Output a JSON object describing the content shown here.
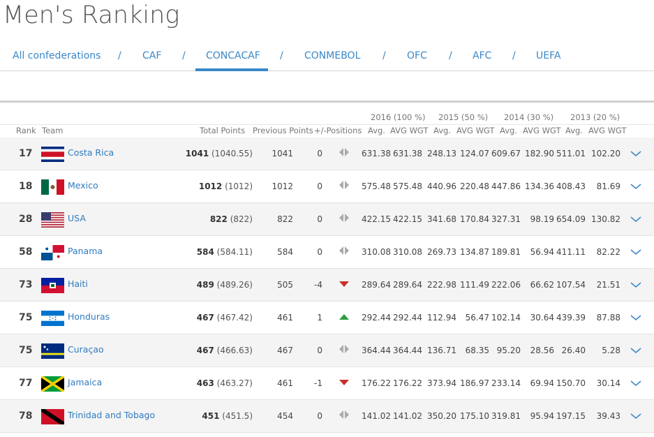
{
  "page_title": "Men's Ranking",
  "tabs": [
    {
      "label": "All confederations",
      "active": false
    },
    {
      "label": "CAF",
      "active": false
    },
    {
      "label": "CONCACAF",
      "active": true
    },
    {
      "label": "CONMEBOL",
      "active": false
    },
    {
      "label": "OFC",
      "active": false
    },
    {
      "label": "AFC",
      "active": false
    },
    {
      "label": "UEFA",
      "active": false
    }
  ],
  "tab_separator": "/",
  "groups": [
    "2016 (100 %)",
    "2015 (50 %)",
    "2014 (30 %)",
    "2013 (20 %)"
  ],
  "headers": {
    "rank": "Rank",
    "team": "Team",
    "total_points": "Total Points",
    "previous_points": "Previous Points",
    "positions": "+/-Positions",
    "avg": "Avg.",
    "avg_wgt": "AVG WGT"
  },
  "colors": {
    "link": "#2f7bc0",
    "up": "#2e9e3e",
    "down": "#c9302c",
    "neutral": "#aaaaaa"
  },
  "rows": [
    {
      "rank": "17",
      "team": "Costa Rica",
      "flag": "costa-rica",
      "points": "1041",
      "points_exact": "(1040.55)",
      "previous": "1041",
      "diff": "0",
      "trend": "same",
      "vals": [
        "631.38",
        "631.38",
        "248.13",
        "124.07",
        "609.67",
        "182.90",
        "511.01",
        "102.20"
      ]
    },
    {
      "rank": "18",
      "team": "Mexico",
      "flag": "mexico",
      "points": "1012",
      "points_exact": "(1012)",
      "previous": "1012",
      "diff": "0",
      "trend": "same",
      "vals": [
        "575.48",
        "575.48",
        "440.96",
        "220.48",
        "447.86",
        "134.36",
        "408.43",
        "81.69"
      ]
    },
    {
      "rank": "28",
      "team": "USA",
      "flag": "usa",
      "points": "822",
      "points_exact": "(822)",
      "previous": "822",
      "diff": "0",
      "trend": "same",
      "vals": [
        "422.15",
        "422.15",
        "341.68",
        "170.84",
        "327.31",
        "98.19",
        "654.09",
        "130.82"
      ]
    },
    {
      "rank": "58",
      "team": "Panama",
      "flag": "panama",
      "points": "584",
      "points_exact": "(584.11)",
      "previous": "584",
      "diff": "0",
      "trend": "same",
      "vals": [
        "310.08",
        "310.08",
        "269.73",
        "134.87",
        "189.81",
        "56.94",
        "411.11",
        "82.22"
      ]
    },
    {
      "rank": "73",
      "team": "Haiti",
      "flag": "haiti",
      "points": "489",
      "points_exact": "(489.26)",
      "previous": "505",
      "diff": "-4",
      "trend": "down",
      "vals": [
        "289.64",
        "289.64",
        "222.98",
        "111.49",
        "222.06",
        "66.62",
        "107.54",
        "21.51"
      ]
    },
    {
      "rank": "75",
      "team": "Honduras",
      "flag": "honduras",
      "points": "467",
      "points_exact": "(467.42)",
      "previous": "461",
      "diff": "1",
      "trend": "up",
      "vals": [
        "292.44",
        "292.44",
        "112.94",
        "56.47",
        "102.14",
        "30.64",
        "439.39",
        "87.88"
      ]
    },
    {
      "rank": "75",
      "team": "Curaçao",
      "flag": "curacao",
      "points": "467",
      "points_exact": "(466.63)",
      "previous": "467",
      "diff": "0",
      "trend": "same",
      "vals": [
        "364.44",
        "364.44",
        "136.71",
        "68.35",
        "95.20",
        "28.56",
        "26.40",
        "5.28"
      ]
    },
    {
      "rank": "77",
      "team": "Jamaica",
      "flag": "jamaica",
      "points": "463",
      "points_exact": "(463.27)",
      "previous": "461",
      "diff": "-1",
      "trend": "down",
      "vals": [
        "176.22",
        "176.22",
        "373.94",
        "186.97",
        "233.14",
        "69.94",
        "150.70",
        "30.14"
      ]
    },
    {
      "rank": "78",
      "team": "Trinidad and Tobago",
      "flag": "trinidad-and-tobago",
      "points": "451",
      "points_exact": "(451.5)",
      "previous": "454",
      "diff": "0",
      "trend": "same",
      "vals": [
        "141.02",
        "141.02",
        "350.20",
        "175.10",
        "319.81",
        "95.94",
        "197.15",
        "39.43"
      ]
    }
  ]
}
